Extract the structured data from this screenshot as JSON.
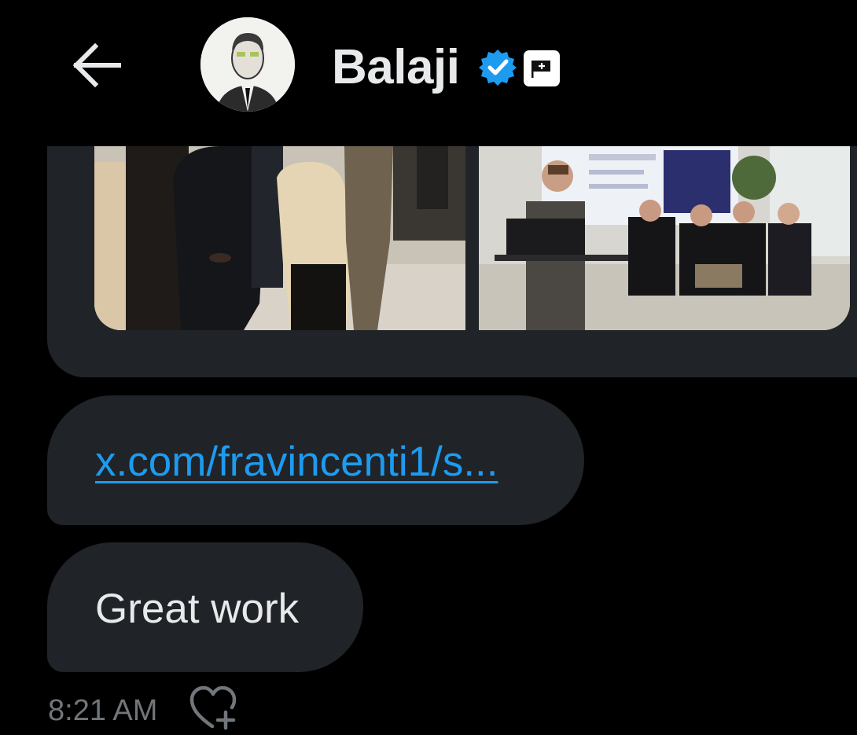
{
  "header": {
    "name": "Balaji",
    "icons": {
      "back": "arrow-left-icon",
      "verified": "verified-check-icon",
      "affiliate": "affiliate-badge-icon"
    }
  },
  "colors": {
    "background": "#000000",
    "bubble": "#202327",
    "link": "#1D9BF0",
    "verified": "#1D9BF0",
    "text": "#E7E9EA",
    "muted": "#71767B"
  },
  "messages": [
    {
      "type": "media",
      "images": [
        "event-crowd-photo",
        "panel-discussion-photo"
      ]
    },
    {
      "type": "link",
      "text": "x.com/fravincenti1/s..."
    },
    {
      "type": "text",
      "text": "Great work"
    }
  ],
  "meta": {
    "timestamp": "8:21 AM",
    "reaction_icon": "add-reaction-heart-icon"
  }
}
